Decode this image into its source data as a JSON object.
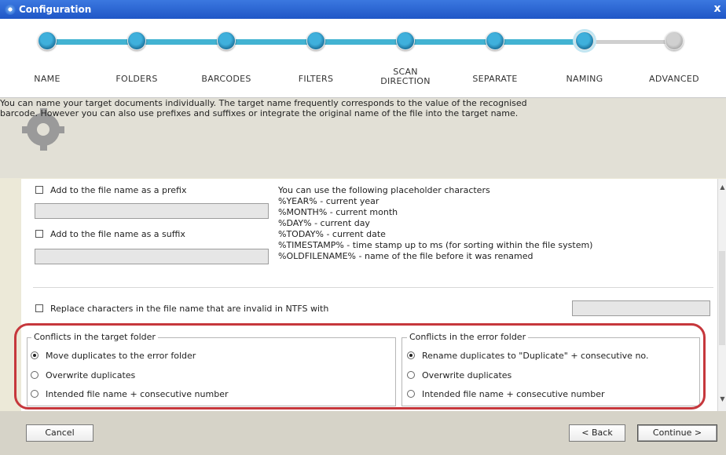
{
  "window": {
    "title": "Configuration",
    "close_glyph": "x"
  },
  "wizard": {
    "steps": [
      {
        "label": "NAME",
        "state": "done"
      },
      {
        "label": "FOLDERS",
        "state": "done"
      },
      {
        "label": "BARCODES",
        "state": "done"
      },
      {
        "label": "FILTERS",
        "state": "done"
      },
      {
        "label": "SCAN DIRECTION",
        "state": "done"
      },
      {
        "label": "SEPARATE",
        "state": "done"
      },
      {
        "label": "NAMING",
        "state": "active"
      },
      {
        "label": "ADVANCED",
        "state": "pending"
      }
    ],
    "progress_color": "#42b3d2"
  },
  "info": {
    "icon": "gear-icon",
    "line1": "You can name your target documents individually. The target name frequently corresponds to the value of the recognised",
    "line2": "barcode. However you can also use prefixes and suffixes or integrate the original name of the file into the target name."
  },
  "naming": {
    "prefix_label": "Add to the file name as a prefix",
    "prefix_checked": false,
    "prefix_value": "",
    "suffix_label": "Add to the file name as a suffix",
    "suffix_checked": false,
    "suffix_value": "",
    "placeholders": [
      "You can use the following placeholder characters",
      "%YEAR% - current year",
      "%MONTH% - current month",
      "%DAY% - current day",
      "%TODAY% - current date",
      "%TIMESTAMP% - time stamp up to ms (for sorting within the file system)",
      "%OLDFILENAME% - name of the file before it was renamed"
    ],
    "replace_label": "Replace characters in the file name that are invalid in NTFS with",
    "replace_checked": false,
    "replace_value": ""
  },
  "conflicts_target": {
    "legend": "Conflicts in the target folder",
    "options": [
      "Move duplicates to the error folder",
      "Overwrite duplicates",
      "Intended file name + consecutive number"
    ],
    "selected": 0
  },
  "conflicts_error": {
    "legend": "Conflicts in the error folder",
    "options": [
      "Rename duplicates to \"Duplicate\" + consecutive no.",
      "Overwrite duplicates",
      "Intended file name + consecutive number"
    ],
    "selected": 0
  },
  "highlight_color": "#c6373c",
  "footer": {
    "cancel": "Cancel",
    "back": "< Back",
    "continue": "Continue >"
  }
}
